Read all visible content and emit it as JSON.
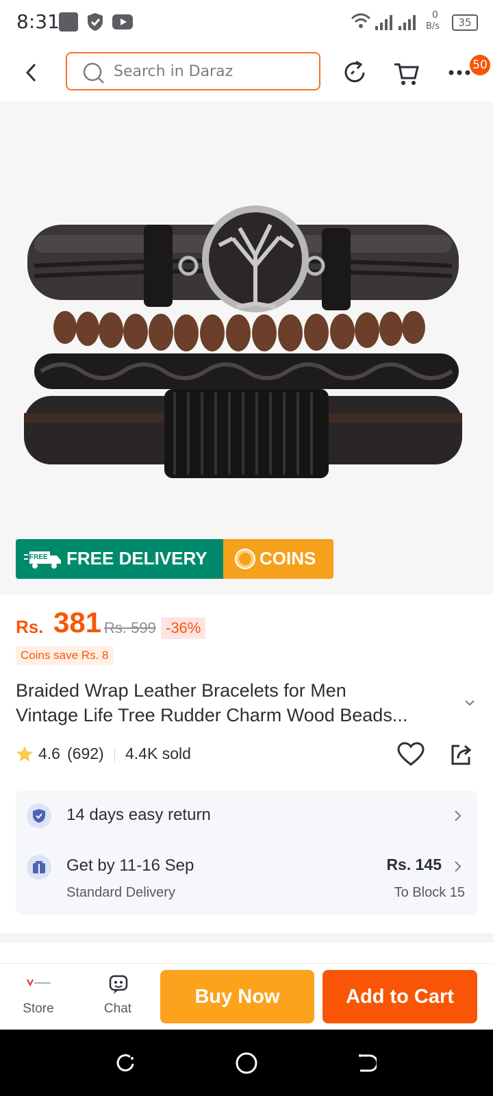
{
  "status_bar": {
    "time": "8:31",
    "net_speed_value": "0",
    "net_speed_unit": "B/s",
    "battery": "35"
  },
  "header": {
    "search_placeholder": "Search in Daraz",
    "badge_count": "50"
  },
  "promo": {
    "free_label": "FREE",
    "free_delivery": "FREE DELIVERY",
    "coins": "COINS"
  },
  "price": {
    "currency": "Rs.",
    "current": "381",
    "original": "Rs. 599",
    "discount": "-36%",
    "coins_save": "Coins save Rs. 8"
  },
  "product": {
    "title_line1": "Braided Wrap Leather Bracelets for Men",
    "title_line2": "Vintage Life Tree Rudder Charm Wood Beads...",
    "rating": "4.6",
    "reviews": "(692)",
    "sold": "4.4K sold"
  },
  "service": {
    "returns": "14 days easy return",
    "delivery": "Get by 11-16 Sep",
    "delivery_type": "Standard Delivery",
    "delivery_fee": "Rs. 145",
    "delivery_to": "To Block 15"
  },
  "bottom": {
    "store_label": "Store",
    "chat_label": "Chat",
    "buy_now": "Buy Now",
    "add_to_cart": "Add to Cart"
  },
  "colors": {
    "brand_orange": "#f85606",
    "buy_now": "#fca21c",
    "free_delivery_green": "#008a6c",
    "coins_yellow": "#f6a11c"
  }
}
